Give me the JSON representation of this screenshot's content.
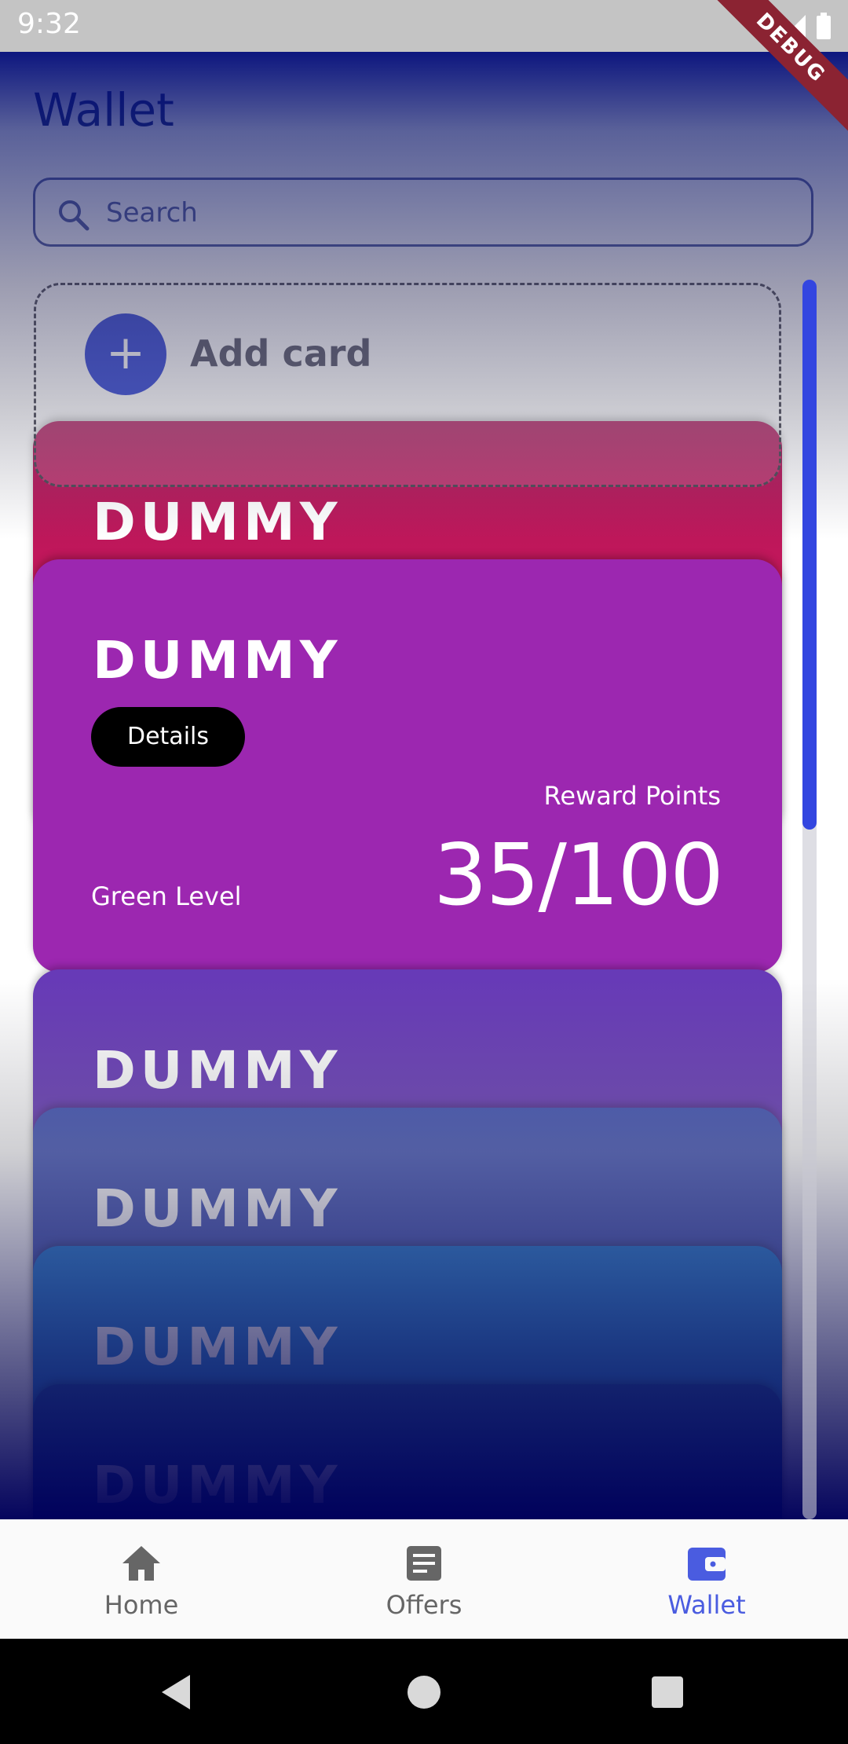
{
  "status_bar": {
    "time": "9:32",
    "debug_label": "DEBUG"
  },
  "header": {
    "title": "Wallet"
  },
  "search": {
    "placeholder": "Search"
  },
  "add_card": {
    "label": "Add card",
    "plus": "+"
  },
  "cards": [
    {
      "brand": "DUMMY",
      "color": "#d81b60"
    },
    {
      "brand": "DUMMY",
      "color": "#9c27b0",
      "details_label": "Details",
      "reward_label": "Reward Points",
      "reward_value": "35/100",
      "level": "Green Level"
    },
    {
      "brand": "DUMMY",
      "color": "#673ab7"
    },
    {
      "brand": "DUMMY",
      "color": "#3f51b5"
    },
    {
      "brand": "DUMMY",
      "color": "#1565c0"
    },
    {
      "brand": "DUMMY",
      "color": "#0d47a1"
    }
  ],
  "bottom_nav": [
    {
      "label": "Home",
      "icon": "home-icon"
    },
    {
      "label": "Offers",
      "icon": "offers-icon"
    },
    {
      "label": "Wallet",
      "icon": "wallet-icon",
      "active": true
    }
  ],
  "colors": {
    "accent": "#4a5ce0",
    "add_button": "#3346d4"
  }
}
